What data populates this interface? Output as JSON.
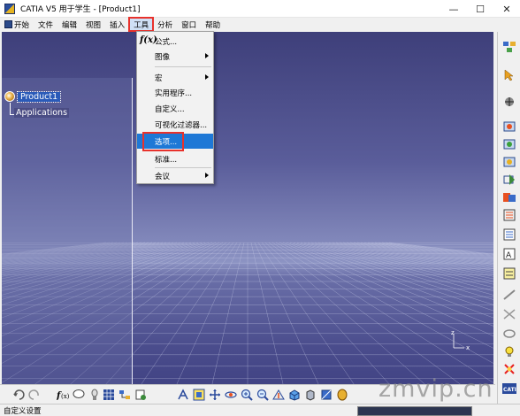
{
  "window": {
    "title": "CATIA V5 用于学生 - [Product1]",
    "minimize": "—",
    "maximize": "☐",
    "close": "✕"
  },
  "menubar": {
    "items": [
      {
        "label": "开始",
        "has_icon": true
      },
      {
        "label": "文件"
      },
      {
        "label": "编辑"
      },
      {
        "label": "视图"
      },
      {
        "label": "插入"
      },
      {
        "label": "工具",
        "active": true
      },
      {
        "label": "分析"
      },
      {
        "label": "窗口"
      },
      {
        "label": "帮助"
      }
    ]
  },
  "tools_menu": {
    "items": [
      {
        "label": "公式...",
        "icon": "formula-icon",
        "icon_text": "f(x)"
      },
      {
        "label": "图像",
        "submenu": true
      },
      {
        "label": "宏",
        "submenu": true
      },
      {
        "label": "实用程序..."
      },
      {
        "label": "自定义..."
      },
      {
        "label": "可视化过滤器..."
      },
      {
        "label": "选项...",
        "selected": true
      },
      {
        "label": "标准..."
      },
      {
        "label": "会议",
        "submenu": true
      }
    ]
  },
  "tree": {
    "root": "Product1",
    "child": "Applications"
  },
  "compass": {
    "z_label": "z",
    "x_label": "x"
  },
  "status": {
    "text": "自定义设置"
  },
  "watermark": "zmvip.cn",
  "colors": {
    "highlight": "#e8322c",
    "selection": "#1e78d6",
    "workspace_top": "#3e3f7a",
    "workspace_mid": "#8c93c3"
  }
}
